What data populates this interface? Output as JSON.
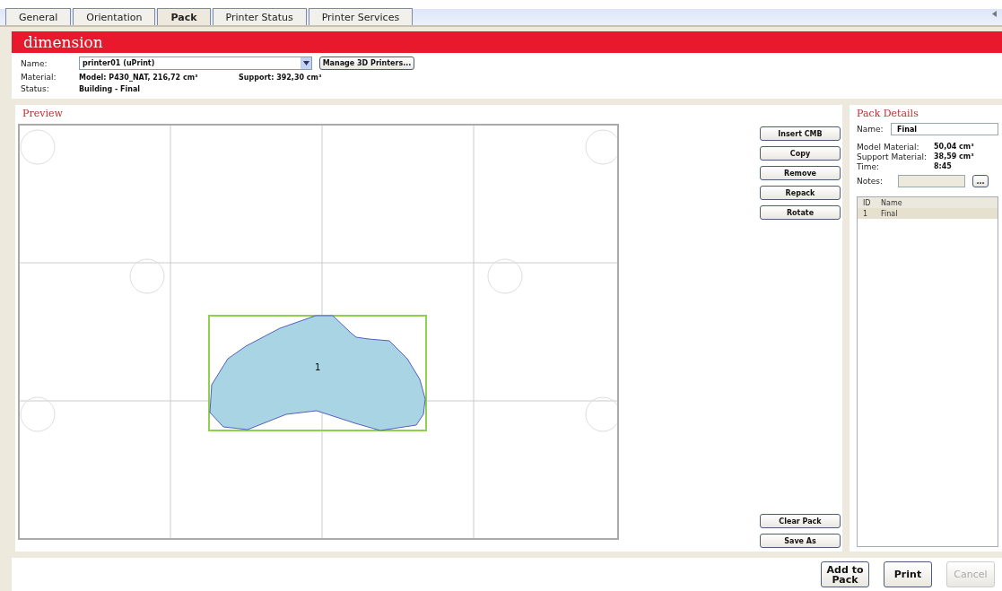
{
  "tabs": [
    {
      "label": "General",
      "selected": false
    },
    {
      "label": "Orientation",
      "selected": false
    },
    {
      "label": "Pack",
      "selected": true
    },
    {
      "label": "Printer Status",
      "selected": false
    },
    {
      "label": "Printer Services",
      "selected": false
    }
  ],
  "brand": "dimension",
  "printer": {
    "name_label": "Name:",
    "name_value": "printer01  (uPrint)",
    "manage_button": "Manage 3D Printers...",
    "material_label": "Material:",
    "model": "Model: P430_NAT, 216,72 cm³",
    "support": "Support: 392,30 cm³",
    "status_label": "Status:",
    "status": "Building - Final"
  },
  "preview": {
    "title": "Preview",
    "part_label": "1"
  },
  "actions": [
    "Insert CMB",
    "Copy",
    "Remove",
    "Repack",
    "Rotate"
  ],
  "bottom_actions": [
    "Clear Pack",
    "Save As"
  ],
  "pack_details": {
    "title": "Pack Details",
    "name_label": "Name:",
    "name_value": "Final",
    "stats": [
      {
        "label": "Model Material:",
        "value": "50,04 cm³"
      },
      {
        "label": "Support Material:",
        "value": "38,59 cm³"
      },
      {
        "label": "Time:",
        "value": "8:45"
      }
    ],
    "notes_label": "Notes:",
    "notes_button": "...",
    "table": {
      "columns": [
        "ID",
        "Name"
      ],
      "rows": [
        {
          "cells": [
            "1",
            "Final"
          ],
          "selected": true
        }
      ]
    }
  },
  "footer": [
    {
      "label": "Add to Pack",
      "disabled": false
    },
    {
      "label": "Print",
      "disabled": false
    },
    {
      "label": "Cancel",
      "disabled": true
    }
  ]
}
